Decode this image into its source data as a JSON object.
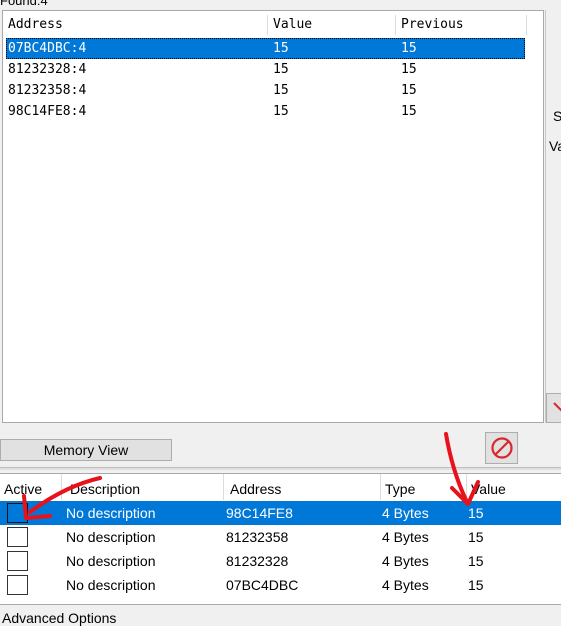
{
  "found_label": "Found:4",
  "results": {
    "columns": [
      "Address",
      "Value",
      "Previous"
    ],
    "rows": [
      {
        "address": "07BC4DBC:4",
        "value": "15",
        "previous": "15",
        "selected": true
      },
      {
        "address": "81232328:4",
        "value": "15",
        "previous": "15",
        "selected": false
      },
      {
        "address": "81232358:4",
        "value": "15",
        "previous": "15",
        "selected": false
      },
      {
        "address": "98C14FE8:4",
        "value": "15",
        "previous": "15",
        "selected": false
      }
    ]
  },
  "right_panel": {
    "label_1": "S",
    "label_2": "Va"
  },
  "memory_view_button": "Memory View",
  "address_list": {
    "columns": [
      "Active",
      "Description",
      "Address",
      "Type",
      "Value"
    ],
    "rows": [
      {
        "description": "No description",
        "address": "98C14FE8",
        "type": "4 Bytes",
        "value": "15",
        "selected": true
      },
      {
        "description": "No description",
        "address": "81232358",
        "type": "4 Bytes",
        "value": "15",
        "selected": false
      },
      {
        "description": "No description",
        "address": "81232328",
        "type": "4 Bytes",
        "value": "15",
        "selected": false
      },
      {
        "description": "No description",
        "address": "07BC4DBC",
        "type": "4 Bytes",
        "value": "15",
        "selected": false
      }
    ]
  },
  "advanced_options": "Advanced Options",
  "colors": {
    "selection": "#0078d7",
    "annotation": "#e8121b",
    "no_entry": "#d9272e"
  },
  "icons": {
    "no_entry": "no-entry-icon",
    "annotation": "red-arrow-icon"
  }
}
